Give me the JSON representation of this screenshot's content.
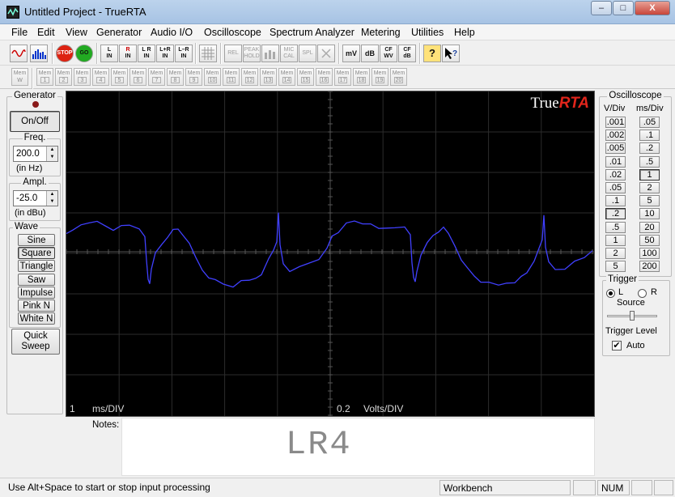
{
  "window": {
    "title": "Untitled Project - TrueRTA",
    "min": "–",
    "max": "□",
    "close": "X"
  },
  "menu": [
    "File",
    "Edit",
    "View",
    "Generator",
    "Audio I/O",
    "Oscilloscope",
    "Spectrum Analyzer",
    "Metering",
    "Utilities",
    "Help"
  ],
  "toolbar": {
    "stop": "STOP",
    "go": "GO",
    "inputs": [
      [
        "L",
        "IN"
      ],
      [
        "R",
        "IN"
      ],
      [
        "L R",
        "IN"
      ],
      [
        "L+R",
        "IN"
      ],
      [
        "L–R",
        "IN"
      ]
    ],
    "dim": [
      [
        "REL",
        ""
      ],
      [
        "PEAK",
        "HOLD"
      ],
      [
        "",
        ""
      ],
      [
        "MIC",
        "CAL"
      ],
      [
        "SPL",
        ""
      ],
      [
        "",
        ""
      ]
    ],
    "units": [
      [
        "mV",
        ""
      ],
      [
        "dB",
        ""
      ],
      [
        "CF",
        "WV"
      ],
      [
        "CF",
        "dB"
      ]
    ],
    "help": "?"
  },
  "memory": {
    "first": [
      "Mem",
      "W"
    ],
    "slots": [
      "1",
      "2",
      "3",
      "4",
      "5",
      "6",
      "7",
      "8",
      "9",
      "10",
      "11",
      "12",
      "13",
      "14",
      "15",
      "16",
      "17",
      "18",
      "19",
      "20"
    ],
    "label": "Mem"
  },
  "generator": {
    "title": "Generator",
    "onoff": "On/Off",
    "freq_title": "Freq.",
    "freq_value": "200.0",
    "freq_unit": "(in Hz)",
    "ampl_title": "Ampl.",
    "ampl_value": "-25.0",
    "ampl_unit": "(in dBu)",
    "wave_title": "Wave",
    "waves": [
      "Sine",
      "Square",
      "Triangle",
      "Saw",
      "Impulse",
      "Pink N",
      "White N"
    ],
    "selected_wave": "Square",
    "quick_sweep_1": "Quick",
    "quick_sweep_2": "Sweep"
  },
  "scope": {
    "brand_a": "True",
    "brand_b": "RTA",
    "time_val": "1",
    "time_unit": "ms/DIV",
    "volt_val": "0.2",
    "volt_unit": "Volts/DIV",
    "trace_color": "#4040ff"
  },
  "notes": {
    "label": "Notes:",
    "text": "LR4"
  },
  "oscilloscope": {
    "title": "Oscilloscope",
    "vdiv_label": "V/Div",
    "msdiv_label": "ms/Div",
    "vdiv": [
      ".001",
      ".002",
      ".005",
      ".01",
      ".02",
      ".05",
      ".1",
      ".2",
      ".5",
      "1",
      "2",
      "5"
    ],
    "msdiv": [
      ".05",
      ".1",
      ".2",
      ".5",
      "1",
      "2",
      "5",
      "10",
      "20",
      "50",
      "100",
      "200"
    ],
    "vdiv_selected": ".2",
    "msdiv_selected": "1",
    "trigger_title": "Trigger",
    "trigger_l": "L",
    "trigger_r": "R",
    "trigger_source": "Source",
    "trigger_level": "Trigger Level",
    "auto": "Auto",
    "auto_checked": "✔"
  },
  "status": {
    "text": "Use Alt+Space to start or stop input processing",
    "mode": "Workbench",
    "num": "NUM"
  }
}
